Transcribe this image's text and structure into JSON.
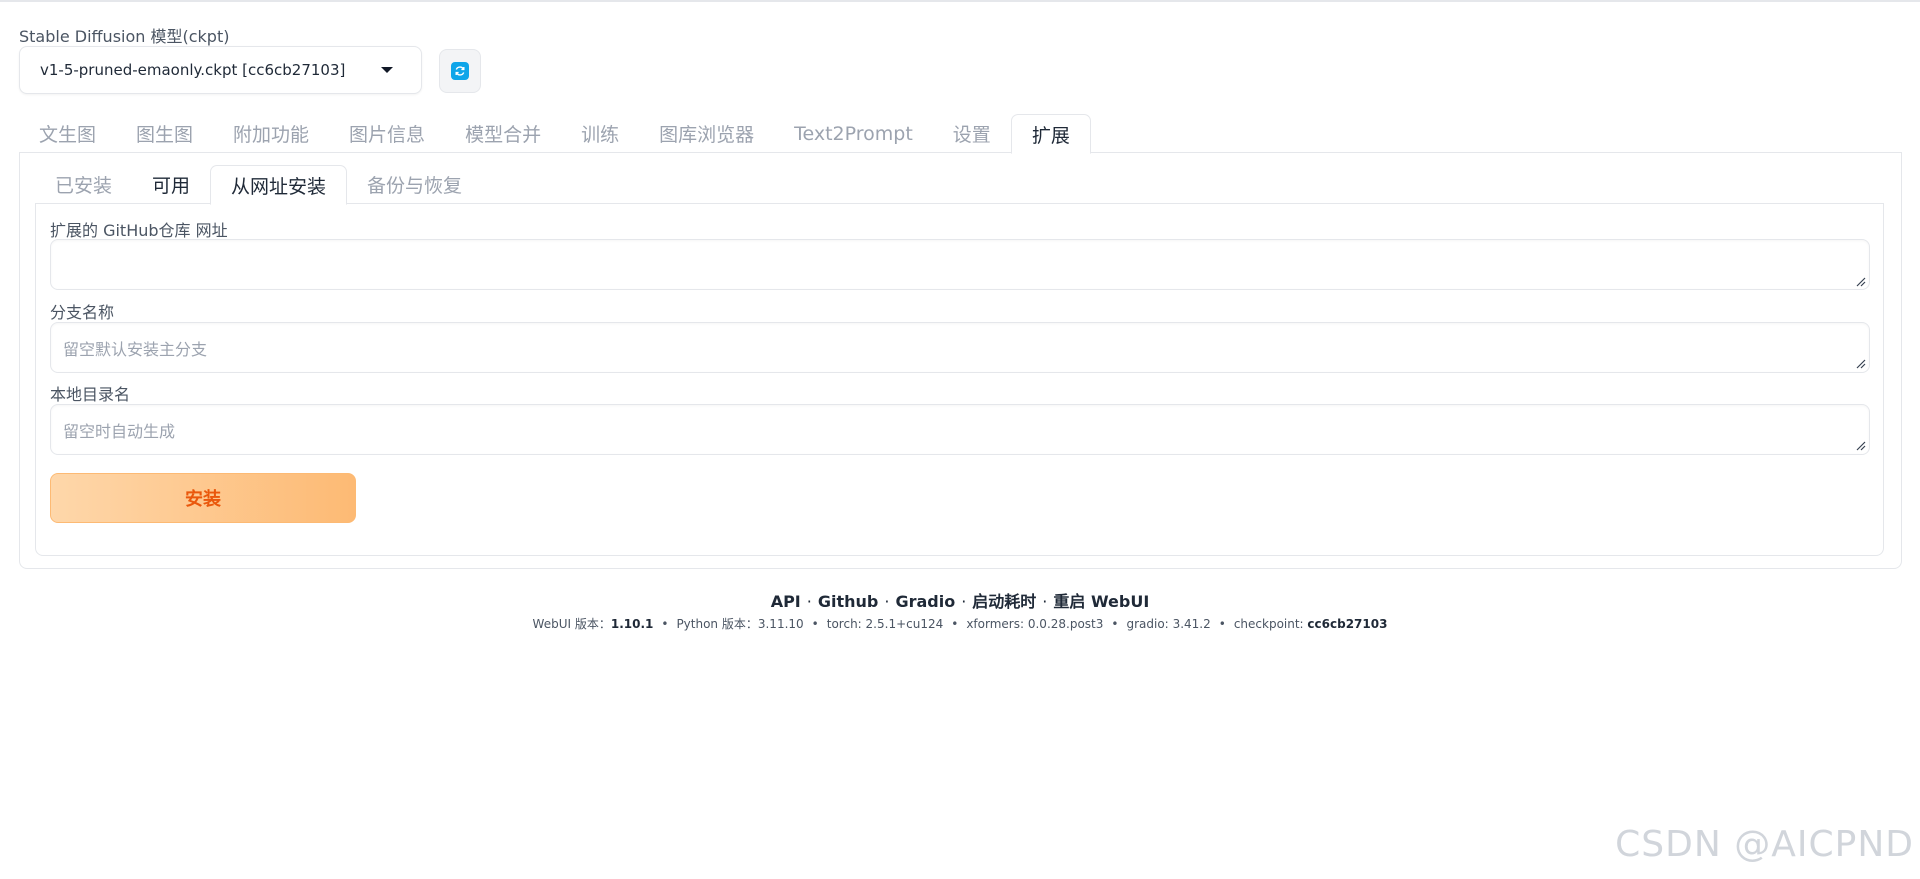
{
  "model": {
    "label": "Stable Diffusion 模型(ckpt)",
    "selected": "v1-5-pruned-emaonly.ckpt [cc6cb27103]"
  },
  "main_tabs": [
    "文生图",
    "图生图",
    "附加功能",
    "图片信息",
    "模型合并",
    "训练",
    "图库浏览器",
    "Text2Prompt",
    "设置",
    "扩展"
  ],
  "active_main_tab": "扩展",
  "sub_tabs": [
    "已安装",
    "可用",
    "从网址安装",
    "备份与恢复"
  ],
  "active_sub_tab": "从网址安装",
  "form": {
    "repo_label": "扩展的 GitHub仓库 网址",
    "repo_value": "",
    "branch_label": "分支名称",
    "branch_placeholder": "留空默认安装主分支",
    "dir_label": "本地目录名",
    "dir_placeholder": "留空时自动生成",
    "install_label": "安装"
  },
  "footer": {
    "links": [
      "API",
      "Github",
      "Gradio",
      "启动耗时",
      "重启 WebUI"
    ],
    "separator": "·",
    "versions": {
      "webui_label": "WebUI 版本：",
      "webui": "1.10.1",
      "python_label": "Python 版本：",
      "python": "3.11.10",
      "torch_label": "torch:",
      "torch": "2.5.1+cu124",
      "xformers_label": "xformers:",
      "xformers": "0.0.28.post3",
      "gradio_label": "gradio:",
      "gradio": "3.41.2",
      "checkpoint_label": "checkpoint:",
      "checkpoint": "cc6cb27103"
    }
  },
  "watermark": "CSDN @AICPND",
  "colors": {
    "accent_orange": "#ea580c",
    "button_gradient_start": "#fed7aa",
    "button_gradient_end": "#fdba74",
    "refresh_icon": "#0ea5e9"
  },
  "icons": [
    "chevron-down-icon",
    "refresh-icon",
    "resize-grip-icon"
  ]
}
